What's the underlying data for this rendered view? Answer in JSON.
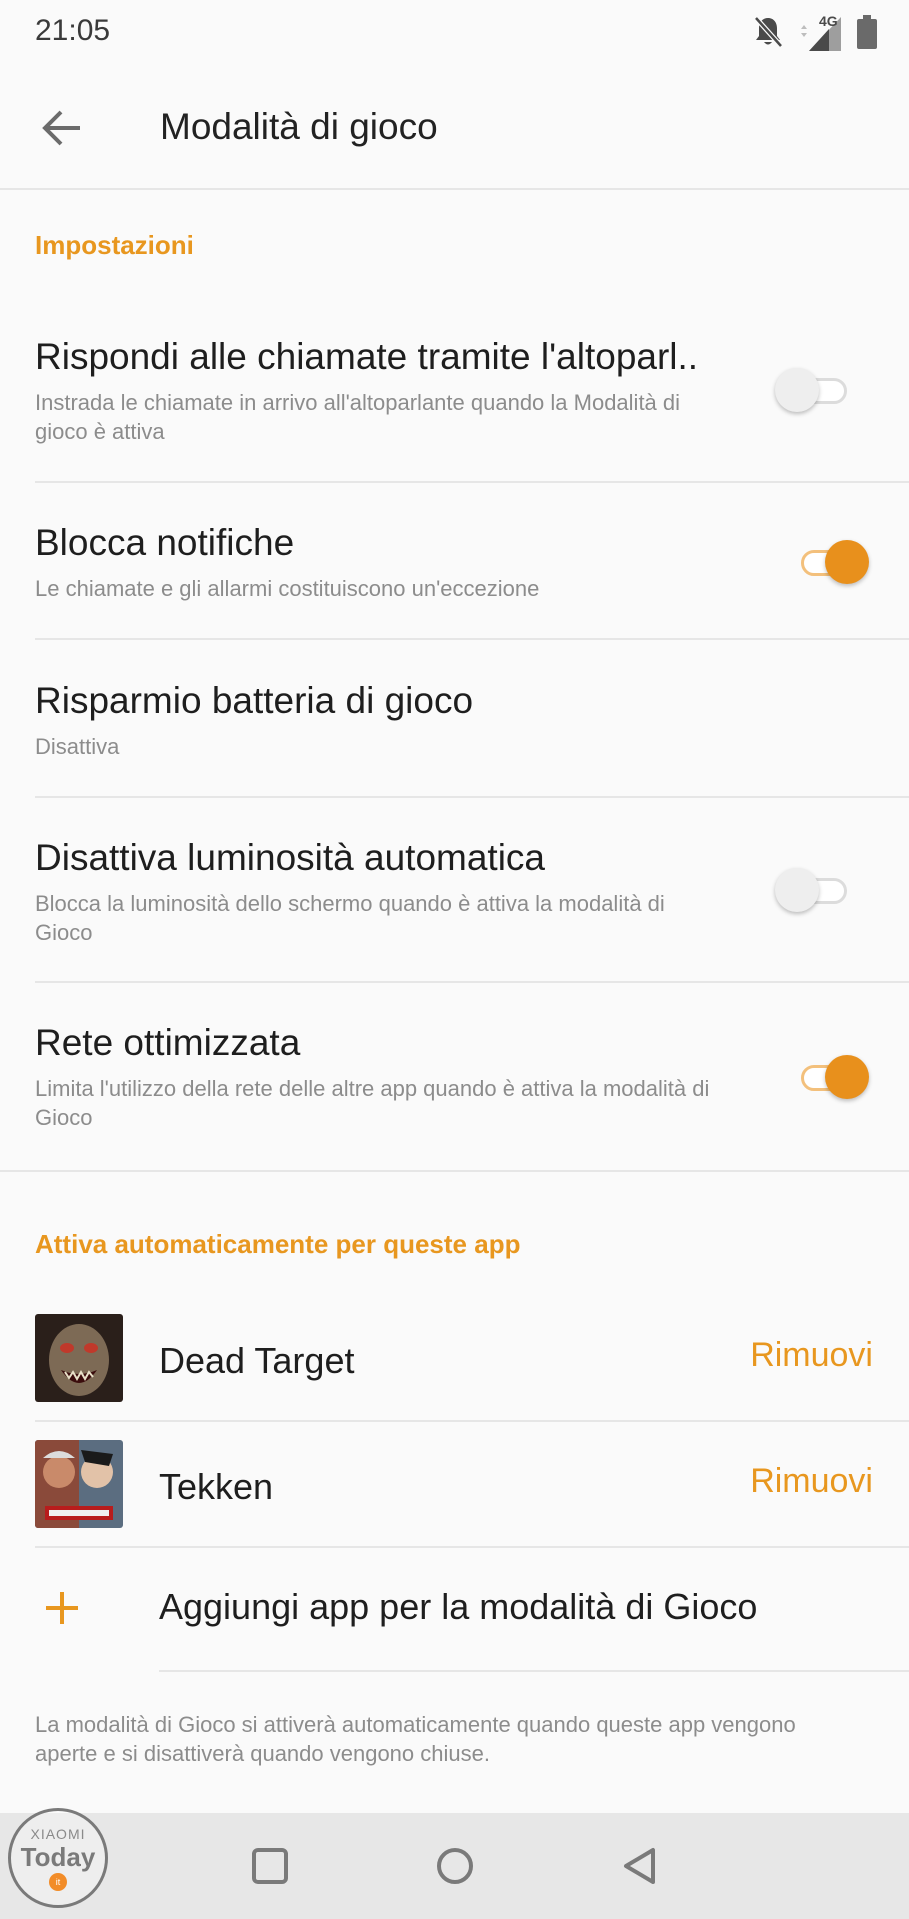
{
  "status_bar": {
    "time": "21:05",
    "network": "4G",
    "icons": [
      "bell-off-icon",
      "signal-icon",
      "battery-icon"
    ]
  },
  "app_bar": {
    "title": "Modalità di gioco",
    "back_icon": "arrow-left-icon"
  },
  "colors": {
    "accent": "#e8971f",
    "divider": "#e6e6e6",
    "subtext": "#8c8c8c"
  },
  "settings_section": {
    "header": "Impostazioni",
    "items": [
      {
        "title": "Rispondi alle chiamate tramite l'altoparl..",
        "subtitle": "Instrada le chiamate in arrivo all'altoparlante quando la Modalità di gioco è attiva",
        "toggle": false
      },
      {
        "title": "Blocca notifiche",
        "subtitle": "Le chiamate e gli allarmi costituiscono un'eccezione",
        "toggle": true
      },
      {
        "title": "Risparmio batteria di gioco",
        "subtitle": "Disattiva"
      },
      {
        "title": "Disattiva luminosità automatica",
        "subtitle": "Blocca la luminosità dello schermo quando è attiva la modalità di Gioco",
        "toggle": false
      },
      {
        "title": "Rete ottimizzata",
        "subtitle": "Limita l'utilizzo della rete delle altre app quando è attiva la modalità di Gioco",
        "toggle": true
      }
    ]
  },
  "apps_section": {
    "header": "Attiva automaticamente per queste app",
    "apps": [
      {
        "name": "Dead Target",
        "action": "Rimuovi"
      },
      {
        "name": "Tekken",
        "action": "Rimuovi"
      }
    ],
    "add_label": "Aggiungi app per la modalità di Gioco",
    "footer_note": "La modalità di Gioco si attiverà automaticamente quando queste app vengono aperte e si disattiverà quando vengono chiuse."
  },
  "watermark": {
    "top": "XIAOMI",
    "main": "Today",
    "suffix": "it"
  }
}
